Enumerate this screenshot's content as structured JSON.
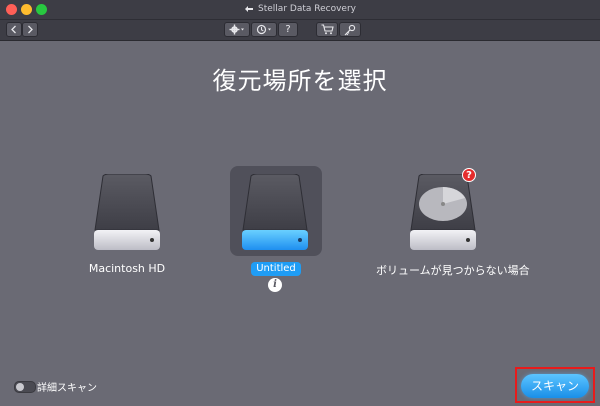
{
  "window": {
    "title": "Stellar Data Recovery"
  },
  "toolbar": {
    "back_icon": "chevron-left-icon",
    "forward_icon": "chevron-right-icon",
    "settings_icon": "gear-icon",
    "history_icon": "history-icon",
    "help_label": "?",
    "cart_icon": "cart-icon",
    "key_icon": "key-icon"
  },
  "main": {
    "heading": "復元場所を選択",
    "drives": [
      {
        "label": "Macintosh HD",
        "selected": false
      },
      {
        "label": "Untitled",
        "selected": true
      },
      {
        "label": "ボリュームが見つからない場合",
        "selected": false,
        "badge": "?"
      }
    ],
    "info_label": "i"
  },
  "footer": {
    "deep_scan_label": "詳細スキャン",
    "deep_scan_on": false,
    "scan_button": "スキャン"
  },
  "colors": {
    "background": "#6a6a74",
    "accent": "#1f9df5",
    "highlight_border": "#e81b1b"
  }
}
